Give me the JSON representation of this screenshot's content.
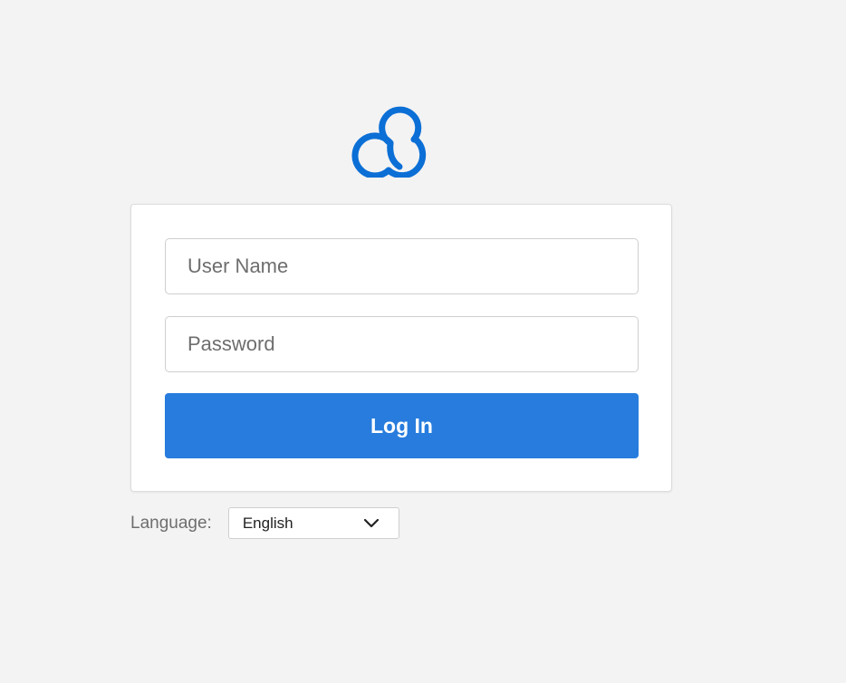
{
  "brand": {
    "logo_icon": "cloud-cluster-icon",
    "accent_color": "#0b6fd6"
  },
  "login_form": {
    "username_placeholder": "User Name",
    "password_placeholder": "Password",
    "login_label": "Log In",
    "button_color": "#277cdd"
  },
  "language": {
    "label": "Language:",
    "selected": "English",
    "icon": "chevron-down-icon"
  }
}
